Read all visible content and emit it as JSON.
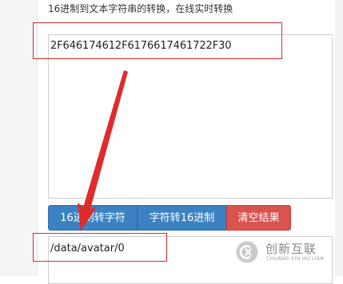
{
  "heading": "16进制到文本字符串的转换，在线实时转换",
  "input": {
    "value": "2F646174612F6176617461722F30"
  },
  "buttons": {
    "hex_to_string": "16进制转字符",
    "string_to_hex": "字符转16进制",
    "clear": "清空结果"
  },
  "output": {
    "value": "/data/avatar/0"
  },
  "watermark": {
    "name_cn": "创新互联",
    "name_en": "CHUANG XIN HU LIAN"
  },
  "colors": {
    "primary_button": "#3c82c3",
    "danger_button": "#d9534f",
    "highlight": "#e02b2b"
  }
}
